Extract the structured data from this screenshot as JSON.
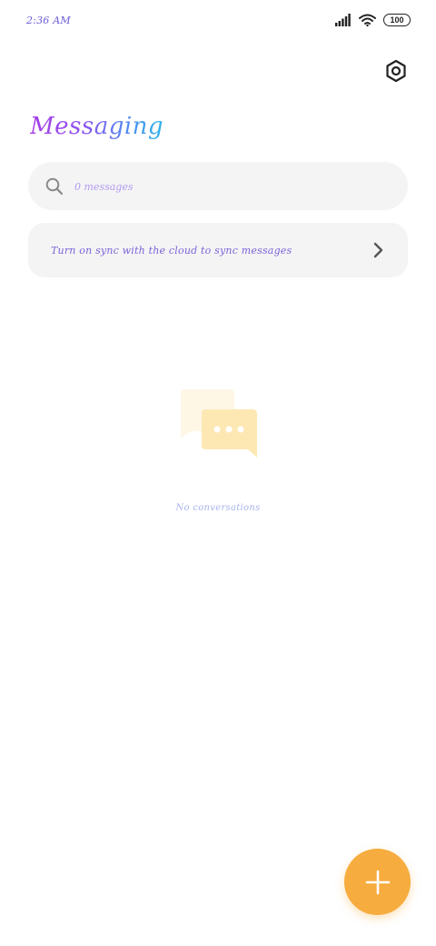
{
  "status_bar": {
    "time": "2:36 AM",
    "battery_level": "100",
    "signal_icon": "signal-bars-icon",
    "wifi_icon": "wifi-icon"
  },
  "header": {
    "settings_icon": "hexagon-gear-icon",
    "title": "Messaging"
  },
  "search": {
    "placeholder": "0 messages",
    "icon": "search-icon"
  },
  "sync_banner": {
    "text": "Turn on sync with the cloud to sync messages",
    "icon": "chevron-right-icon"
  },
  "empty_state": {
    "icon": "chat-bubbles-icon",
    "text": "No conversations"
  },
  "fab": {
    "icon": "plus-icon"
  },
  "colors": {
    "accent": "#f6ac3e",
    "card_bg": "#f4f4f5",
    "title_gradient_start": "#a63de8",
    "title_gradient_end": "#2fb5e8",
    "empty_bubble": "#fde8b4"
  }
}
